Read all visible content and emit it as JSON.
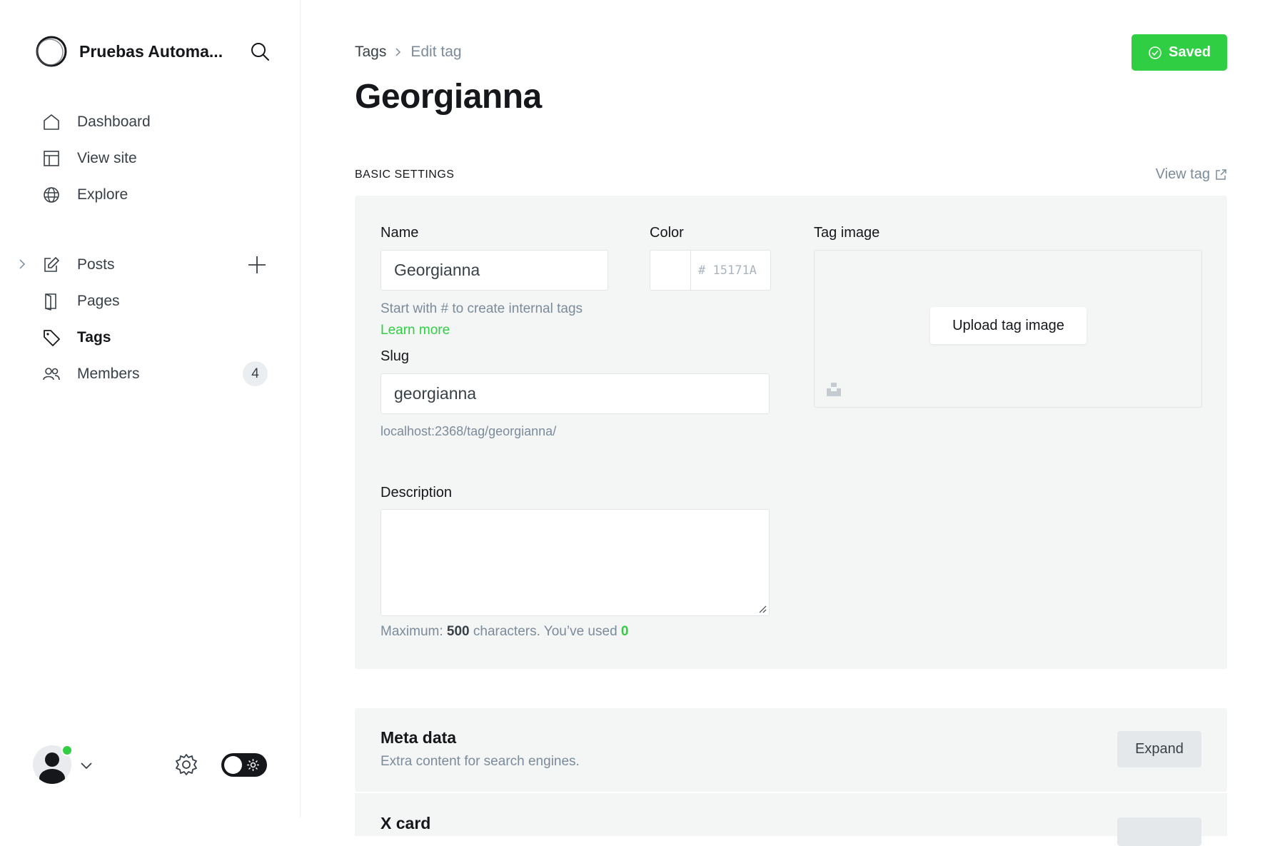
{
  "sidebar": {
    "site_title": "Pruebas Automa...",
    "nav_top": [
      {
        "label": "Dashboard",
        "icon": "home-icon"
      },
      {
        "label": "View site",
        "icon": "layout-icon"
      },
      {
        "label": "Explore",
        "icon": "globe-icon"
      }
    ],
    "nav_content": [
      {
        "label": "Posts",
        "icon": "edit-icon"
      },
      {
        "label": "Pages",
        "icon": "pages-icon"
      },
      {
        "label": "Tags",
        "icon": "tag-icon",
        "active": true
      },
      {
        "label": "Members",
        "icon": "members-icon",
        "count": "4"
      }
    ]
  },
  "header": {
    "breadcrumb_parent": "Tags",
    "breadcrumb_current": "Edit tag",
    "title": "Georgianna",
    "save_status": "Saved"
  },
  "basic_settings": {
    "section_title": "BASIC SETTINGS",
    "view_tag_label": "View tag",
    "name_label": "Name",
    "name_value": "Georgianna",
    "name_hint": "Start with # to create internal tags",
    "learn_more": "Learn more",
    "color_label": "Color",
    "color_prefix": "#",
    "color_placeholder": "15171A",
    "tag_image_label": "Tag image",
    "upload_label": "Upload tag image",
    "slug_label": "Slug",
    "slug_value": "georgianna",
    "slug_url": "localhost:2368/tag/georgianna/",
    "description_label": "Description",
    "description_value": "",
    "char_prefix": "Maximum:",
    "char_max": "500",
    "char_mid": "characters. You’ve used",
    "char_used": "0"
  },
  "meta_data": {
    "title": "Meta data",
    "description": "Extra content for search engines.",
    "expand_label": "Expand"
  },
  "x_card": {
    "title": "X card"
  },
  "colors": {
    "accent_green": "#30cf43",
    "text_dark": "#15171a",
    "text_muted": "#7c8b9a",
    "panel_bg": "#f4f5f5"
  }
}
